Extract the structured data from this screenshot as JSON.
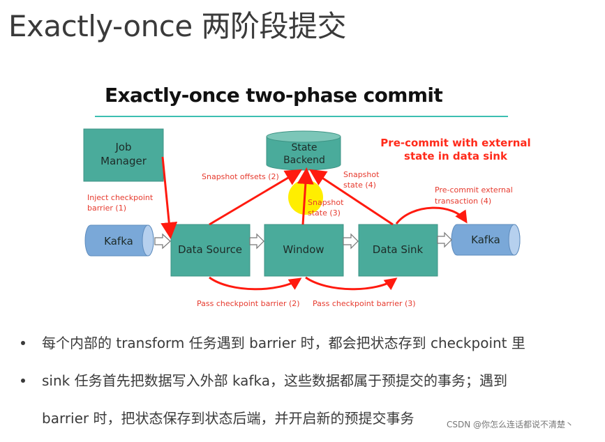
{
  "page_title": "Exactly-once 两阶段提交",
  "diagram": {
    "title": "Exactly-once two-phase commit",
    "nodes": {
      "job_manager": [
        "Job",
        "Manager"
      ],
      "state_backend": [
        "State",
        "Backend"
      ],
      "kafka_in": "Kafka",
      "data_source": "Data Source",
      "window": "Window",
      "data_sink": "Data Sink",
      "kafka_out": "Kafka"
    },
    "headline": [
      "Pre-commit with external",
      "state in data sink"
    ],
    "annotations": {
      "inject_barrier": [
        "Inject checkpoint",
        "barrier (1)"
      ],
      "snapshot_offsets": "Snapshot offsets (2)",
      "snapshot_state_3": [
        "Snapshot",
        "state (3)"
      ],
      "snapshot_state_4": [
        "Snapshot",
        "state (4)"
      ],
      "precommit_tx": [
        "Pre-commit external",
        "transaction (4)"
      ],
      "pass_barrier_2": "Pass checkpoint barrier (2)",
      "pass_barrier_3": "Pass checkpoint barrier (3)"
    },
    "colors": {
      "box_fill": "#4aab9b",
      "kafka_fill": "#7aa8d8",
      "arrow_red": "#ff1a0f",
      "annotation_red": "#e63a2e",
      "highlight": "#ffee00",
      "title_rule": "#3cbfb1"
    }
  },
  "bullets": [
    "每个内部的 transform 任务遇到 barrier 时，都会把状态存到 checkpoint 里",
    "sink 任务首先把数据写入外部 kafka，这些数据都属于预提交的事务；遇到",
    "barrier 时，把状态保存到状态后端，并开启新的预提交事务"
  ],
  "watermark": "CSDN @你怎么连话都说不清楚丶"
}
